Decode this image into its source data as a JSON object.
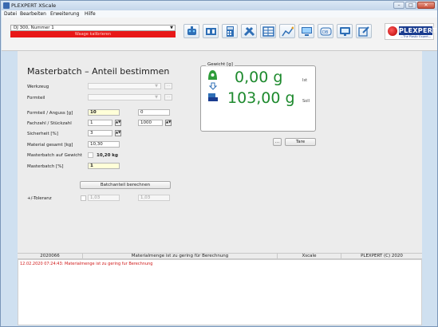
{
  "window": {
    "title": "PLEXPERT XScale",
    "controls": {
      "minimize": "–",
      "maximize": "□",
      "close": "✕"
    }
  },
  "menu": [
    {
      "label": "Datei"
    },
    {
      "label": "Bearbeiten"
    },
    {
      "label": "Erweiterung"
    },
    {
      "label": "Hilfe"
    }
  ],
  "toolbar": {
    "device": "DJ 300, Nummer 1",
    "calibrate": "Waage kalibrieren",
    "icons": [
      "robot-icon",
      "film-icon",
      "calculator-icon",
      "tools-icon",
      "table-icon",
      "chart-icon",
      "monitor-icon",
      "database-icon",
      "screen-icon",
      "edit-icon"
    ],
    "logo": {
      "text": "PLEXPERT",
      "tagline": "—The Plastic Expert—"
    }
  },
  "form": {
    "heading": "Masterbatch – Anteil bestimmen",
    "werkzeug": {
      "label": "Werkzeug",
      "value": ""
    },
    "formteil": {
      "label": "Formteil",
      "value": ""
    },
    "formteil_anguss": {
      "label": "Formteil / Anguss [g]",
      "value1": "10",
      "value2": "0"
    },
    "fachzahl": {
      "label": "Fachzahl / Stückzahl",
      "value1": "1",
      "value2": "1000"
    },
    "sicherheit": {
      "label": "Sicherheit [%]",
      "value": "3"
    },
    "material_gesamt": {
      "label": "Material gesamt [kg]",
      "value": "10,30"
    },
    "masterbatch_gewicht": {
      "label": "Masterbatch auf Gewicht",
      "value": "10,20 kg"
    },
    "masterbatch_pct": {
      "label": "Masterbatch [%]",
      "value": "1"
    },
    "calc_button": "Batchanteil berechnen",
    "toleranz": {
      "label": "+/-Toleranz",
      "value1": "1,03",
      "value2": "1,03"
    }
  },
  "weight": {
    "legend": "Gewicht [g]",
    "ist": {
      "value": "0,00 g",
      "label": "Ist"
    },
    "soll": {
      "value": "103,00 g",
      "label": "Soll"
    },
    "dots_button": "...",
    "tare_button": "Tare"
  },
  "status": {
    "id": "2020066",
    "message": "Materialmenge ist zu gering für Berechnung",
    "module": "Xscale",
    "copyright": "PLEXPERT (C) 2020"
  },
  "log": {
    "entry": "12.02.2020 07:24:43: Materialmenge ist zu gering fur Berechnung"
  }
}
